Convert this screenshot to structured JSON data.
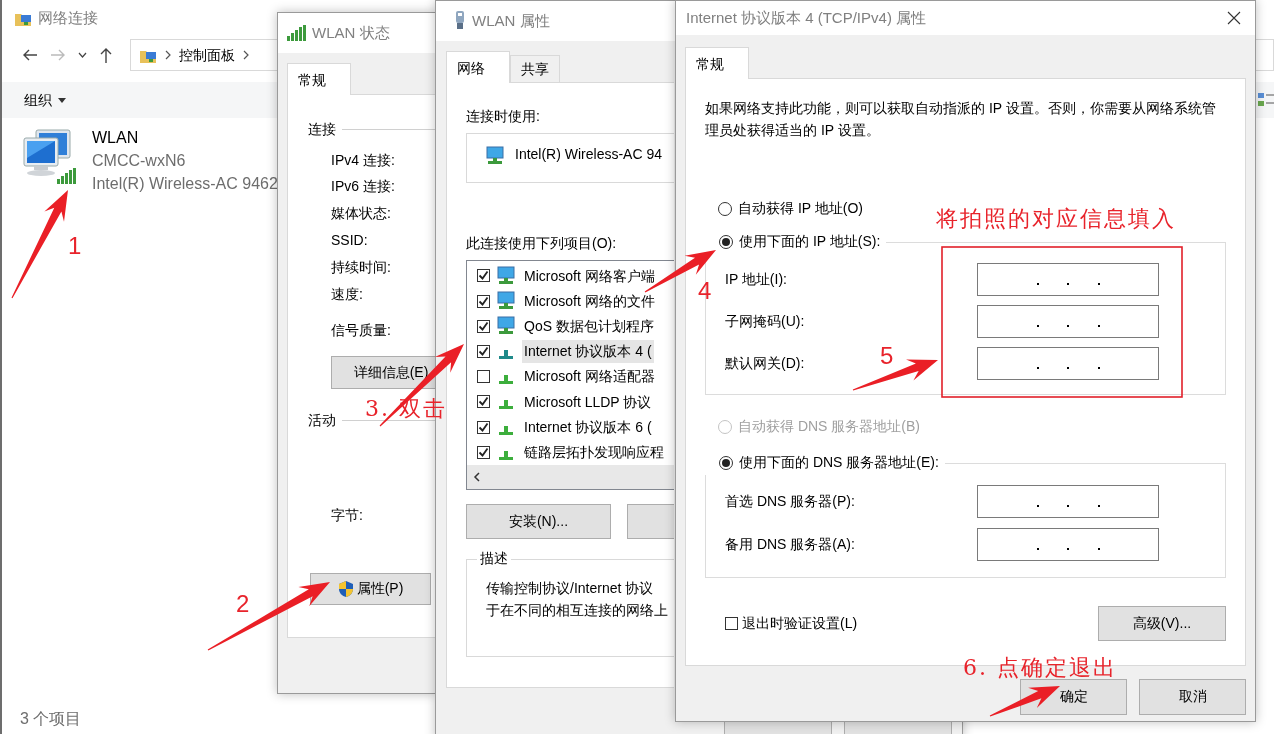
{
  "explorer": {
    "title": "网络连接",
    "breadcrumb": [
      "控制面板"
    ],
    "toolbar": {
      "organize": "组织"
    },
    "items": [
      {
        "name": "WLAN",
        "network": "CMCC-wxN6",
        "adapter": "Intel(R) Wireless-AC 9462"
      }
    ],
    "status_bar": "3 个项目"
  },
  "wlan_status": {
    "title": "WLAN 状态",
    "tabs": [
      {
        "label": "常规",
        "selected": true
      }
    ],
    "connection": {
      "heading": "连接",
      "fields": [
        "IPv4 连接:",
        "IPv6 连接:",
        "媒体状态:",
        "SSID:",
        "持续时间:",
        "速度:"
      ],
      "signal_label": "信号质量:",
      "details_button": "详细信息(E)"
    },
    "activity": {
      "heading": "活动",
      "bytes_label": "字节:"
    },
    "properties_button": "属性(P)"
  },
  "wlan_properties": {
    "title": "WLAN 属性",
    "tabs": [
      {
        "label": "网络",
        "selected": true
      },
      {
        "label": "共享",
        "selected": false
      }
    ],
    "connect_using_label": "连接时使用:",
    "adapter": "Intel(R) Wireless-AC 94",
    "items_label": "此连接使用下列项目(O):",
    "items": [
      {
        "label": "Microsoft 网络客户端",
        "checked": true,
        "selected": false,
        "kind": "client"
      },
      {
        "label": "Microsoft 网络的文件",
        "checked": true,
        "selected": false,
        "kind": "client"
      },
      {
        "label": "QoS 数据包计划程序",
        "checked": true,
        "selected": false,
        "kind": "client"
      },
      {
        "label": "Internet 协议版本 4 (",
        "checked": true,
        "selected": true,
        "kind": "protocol"
      },
      {
        "label": "Microsoft 网络适配器",
        "checked": false,
        "selected": false,
        "kind": "protocol"
      },
      {
        "label": "Microsoft LLDP 协议",
        "checked": true,
        "selected": false,
        "kind": "protocol"
      },
      {
        "label": "Internet 协议版本 6 (",
        "checked": true,
        "selected": false,
        "kind": "protocol"
      },
      {
        "label": "链路层拓扑发现响应程",
        "checked": true,
        "selected": false,
        "kind": "protocol"
      }
    ],
    "install_button": "安装(N)...",
    "description": {
      "heading": "描述",
      "lines": [
        "传输控制协议/Internet 协议",
        "于在不同的相互连接的网络上"
      ]
    }
  },
  "ipv4_dialog": {
    "title": "Internet 协议版本 4 (TCP/IPv4) 属性",
    "tabs": [
      {
        "label": "常规",
        "selected": true
      }
    ],
    "intro": "如果网络支持此功能，则可以获取自动指派的 IP 设置。否则，你需要从网络系统管理员处获得适当的 IP 设置。",
    "ip_mode": [
      {
        "label": "自动获得 IP 地址(O)",
        "selected": false
      },
      {
        "label": "使用下面的 IP 地址(S):",
        "selected": true
      }
    ],
    "ip_fields": [
      "IP 地址(I):",
      "子网掩码(U):",
      "默认网关(D):"
    ],
    "dns_mode": [
      {
        "label": "自动获得 DNS 服务器地址(B)",
        "selected": false,
        "disabled": true
      },
      {
        "label": "使用下面的 DNS 服务器地址(E):",
        "selected": true,
        "disabled": false
      }
    ],
    "dns_fields": [
      "首选 DNS 服务器(P):",
      "备用 DNS 服务器(A):"
    ],
    "validate_on_exit": {
      "label": "退出时验证设置(L)",
      "checked": false
    },
    "advanced_button": "高级(V)...",
    "buttons": [
      "确定",
      "取消"
    ]
  },
  "annotations": [
    "1",
    "2",
    "3. 双击",
    "4",
    "5",
    "将拍照的对应信息填入",
    "6. 点确定退出"
  ]
}
